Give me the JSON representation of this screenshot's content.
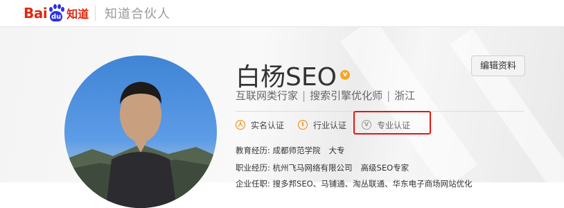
{
  "header": {
    "logo_bai": "Bai",
    "logo_du": "du",
    "logo_zhidao": "知道",
    "title": "知道合伙人"
  },
  "profile": {
    "name": "白杨SEO",
    "badge": "v",
    "edit_button": "编辑资料",
    "tagline": {
      "role": "互联网类行家",
      "job": "搜索引擎优化师",
      "location": "浙江",
      "separator": "|"
    },
    "certifications": [
      {
        "label": "实名认证",
        "icon": "person-cert-icon",
        "icon_glyph": "人"
      },
      {
        "label": "行业认证",
        "icon": "industry-cert-icon",
        "icon_glyph": "I"
      },
      {
        "label": "专业认证",
        "icon": "pro-cert-icon",
        "icon_glyph": "V"
      }
    ],
    "education": {
      "label": "教育经历:",
      "school": "成都师范学院",
      "degree": "大专"
    },
    "career": {
      "label": "职业经历:",
      "company": "杭州飞马网络有限公司",
      "title": "高级SEO专家"
    },
    "partial_line": "企业任职: 搜多邦SEO、马铺通、淘丛联通、华东电子商场网站优化"
  },
  "colors": {
    "brand_red": "#de2910",
    "brand_blue": "#2932e1",
    "highlight": "#e5140f",
    "cert_orange": "#f08300"
  }
}
